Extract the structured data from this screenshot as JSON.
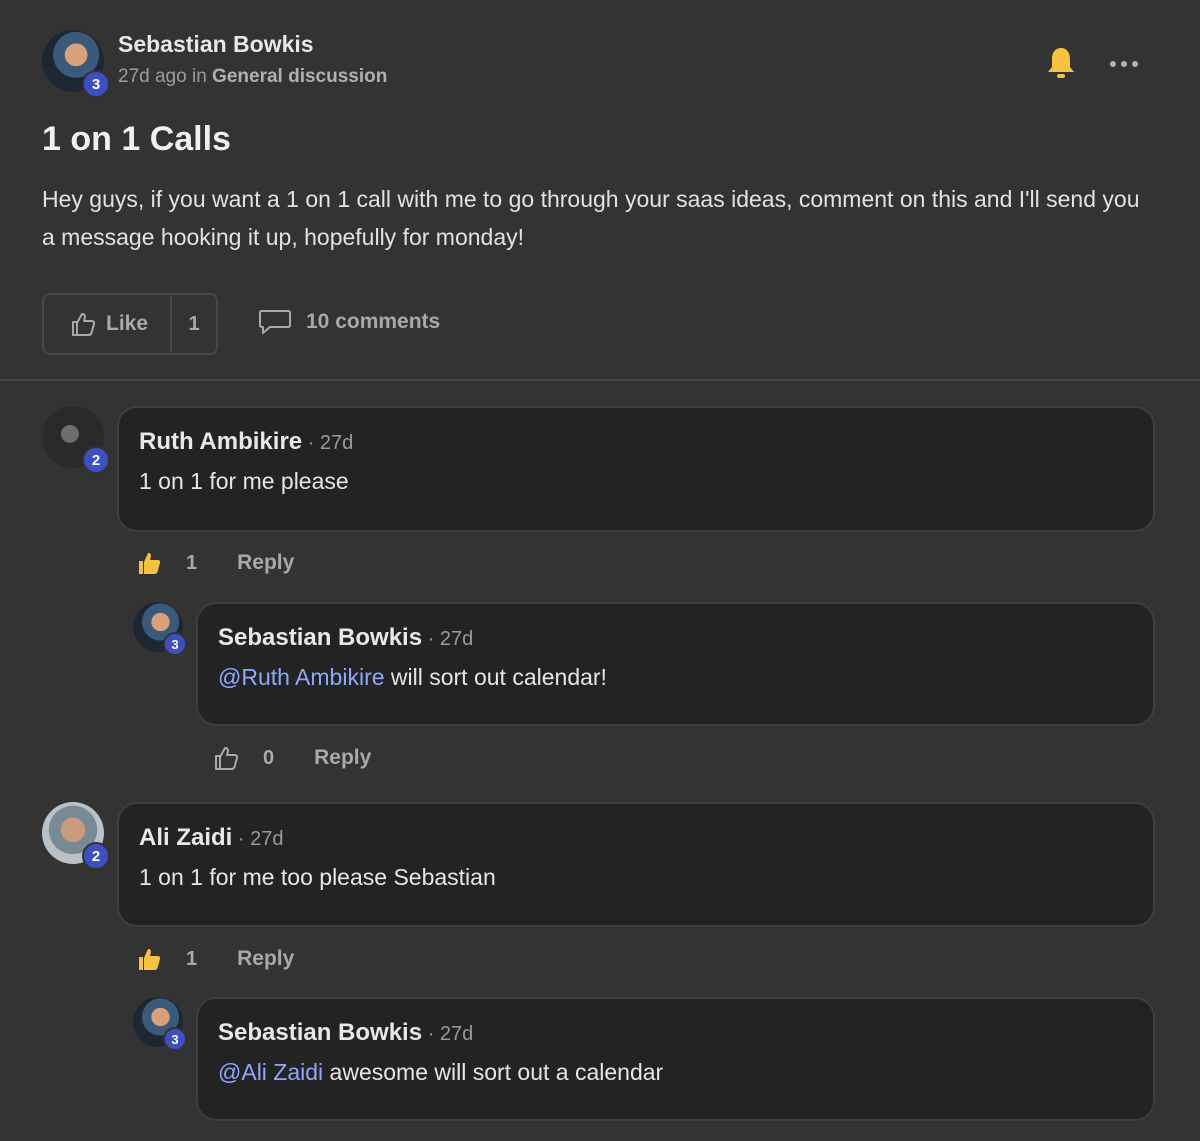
{
  "post": {
    "author": "Sebastian Bowkis",
    "author_level": "3",
    "time_ago": "27d ago",
    "in_word": "in",
    "category": "General discussion",
    "title": "1 on 1 Calls",
    "body": "Hey guys, if you want a 1 on 1 call with me to go through your saas ideas, comment on this and I'll send you a message hooking it up, hopefully for monday!",
    "like_label": "Like",
    "like_count": "1",
    "comments_label": "10 comments",
    "bell_icon": "bell-icon",
    "bell_color": "#f5c242",
    "more_icon": "more-horizontal-icon"
  },
  "comments": [
    {
      "author": "Ruth Ambikire",
      "level": "2",
      "time": " · 27d",
      "text": "1 on 1 for me please",
      "likes": "1",
      "liked": true,
      "reply_label": "Reply",
      "replies": [
        {
          "author": "Sebastian Bowkis",
          "level": "3",
          "time": " · 27d",
          "mention": "@Ruth Ambikire",
          "text": " will sort out calendar!",
          "likes": "0",
          "liked": false,
          "reply_label": "Reply"
        }
      ]
    },
    {
      "author": "Ali Zaidi",
      "level": "2",
      "time": " · 27d",
      "text": "1 on 1 for me too please Sebastian",
      "likes": "1",
      "liked": true,
      "reply_label": "Reply",
      "replies": [
        {
          "author": "Sebastian Bowkis",
          "level": "3",
          "time": " · 27d",
          "mention": "@Ali Zaidi",
          "text": " awesome will sort out a calendar"
        }
      ]
    }
  ],
  "colors": {
    "liked": "#f5c242",
    "mention": "#8fa8ff",
    "level_badge": "#3d4fc2"
  }
}
